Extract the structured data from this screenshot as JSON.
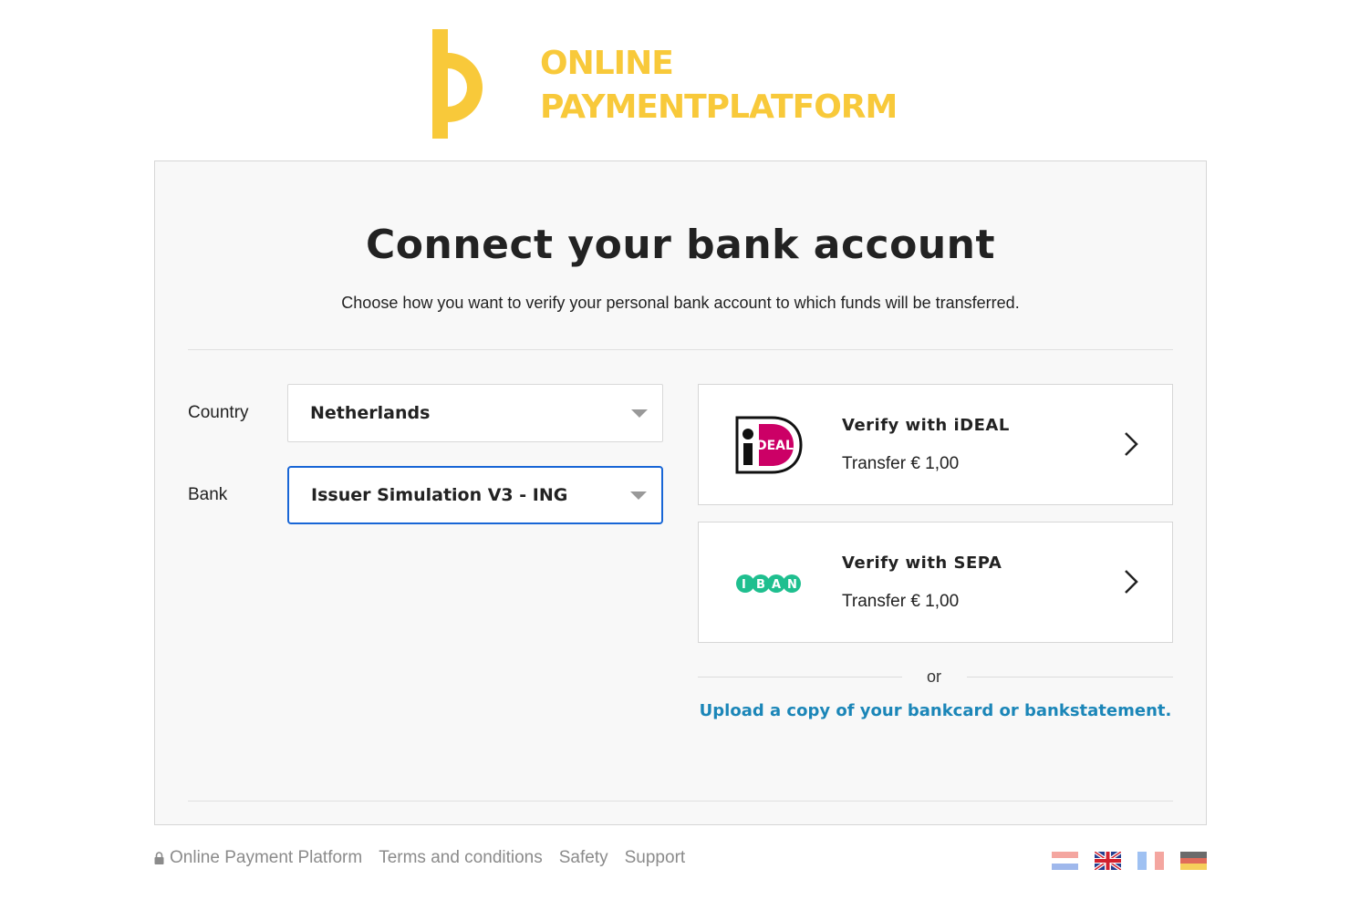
{
  "brand": {
    "line1": "ONLINE",
    "line2": "PAYMENTPLATFORM",
    "color": "#f8c93a"
  },
  "page": {
    "title": "Connect your bank account",
    "subtitle": "Choose how you want to verify your personal bank account to which funds will be transferred."
  },
  "form": {
    "country_label": "Country",
    "country_value": "Netherlands",
    "bank_label": "Bank",
    "bank_value": "Issuer Simulation V3 - ING"
  },
  "options": [
    {
      "title": "Verify with iDEAL",
      "subtitle": "Transfer € 1,00",
      "icon": "ideal-logo-icon"
    },
    {
      "title": "Verify with SEPA",
      "subtitle": "Transfer € 1,00",
      "icon": "iban-logo-icon"
    }
  ],
  "or_text": "or",
  "upload_link": "Upload a copy of your bankcard or bankstatement.",
  "footer": {
    "brand": "Online Payment Platform",
    "links": [
      "Terms and conditions",
      "Safety",
      "Support"
    ]
  },
  "languages": [
    "nl-flag-icon",
    "uk-flag-icon",
    "fr-flag-icon",
    "de-flag-icon"
  ],
  "colors": {
    "accent_link": "#1b86b8",
    "focus_border": "#1866d6",
    "ideal_pink": "#cc0066",
    "iban_green": "#1fbf8f"
  }
}
